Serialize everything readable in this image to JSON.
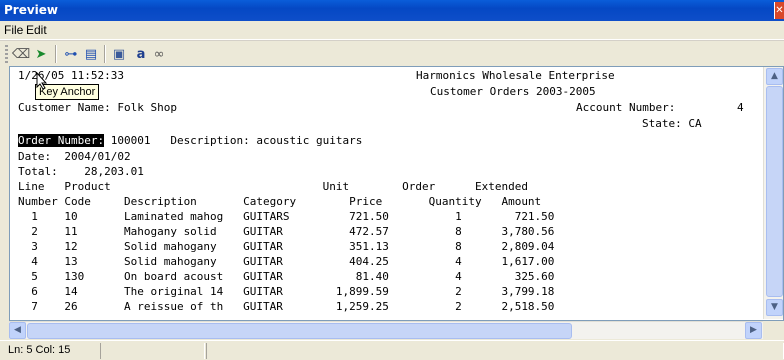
{
  "window": {
    "title": "Preview",
    "close_label": "✕"
  },
  "menu": {
    "file": "File",
    "edit": "Edit"
  },
  "toolbar": {
    "buttons": [
      {
        "name": "eraser-icon",
        "glyph": "⌫"
      },
      {
        "name": "key-anchor-icon",
        "glyph": "➤"
      },
      {
        "name": "tree-icon",
        "glyph": "⊶"
      },
      {
        "name": "list-icon",
        "glyph": "▤"
      },
      {
        "name": "page-icon",
        "glyph": "▣"
      },
      {
        "name": "find-icon",
        "glyph": "a"
      },
      {
        "name": "link-icon",
        "glyph": "∞"
      }
    ]
  },
  "tooltip": "Key Anchor",
  "report": {
    "timestamp": "1/26/05 11:52:33",
    "company": "Harmonics Wholesale Enterprise",
    "subtitle": "Customer Orders 2003-2005",
    "customer_label": "Customer Name: Folk Shop",
    "account_label": "Account Number:",
    "account_value": "4",
    "state_label": "State: CA",
    "order_label": "Order Number:",
    "order_rest": " 100001   Description: acoustic guitars",
    "date_line": "Date:  2004/01/02",
    "total_line": "Total:    28,203.01",
    "header1": "Line   Product                                Unit        Order      Extended",
    "header2": "Number Code     Description       Category        Price       Quantity   Amount",
    "rows": [
      "  1    10       Laminated mahog   GUITARS         721.50          1        721.50",
      "  2    11       Mahogany solid    GUITAR          472.57          8      3,780.56",
      "  3    12       Solid mahogany    GUITAR          351.13          8      2,809.04",
      "  4    13       Solid mahogany    GUITAR          404.25          4      1,617.00",
      "  5    130      On board acoust   GUITAR           81.40          4        325.60",
      "  6    14       The original 14   GUITAR        1,899.59          2      3,799.18",
      "  7    26       A reissue of th   GUITAR        1,259.25          2      2,518.50"
    ]
  },
  "status": {
    "position": "Ln:   5 Col:   15"
  }
}
